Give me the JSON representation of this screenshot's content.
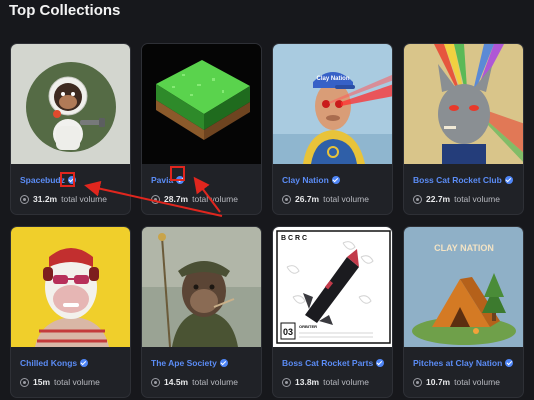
{
  "page": {
    "title": "Top Collections"
  },
  "collections": [
    {
      "name": "Spacebudz",
      "volume": "31.2m",
      "volume_label": "total volume",
      "verified": true
    },
    {
      "name": "Pavia",
      "volume": "28.7m",
      "volume_label": "total volume",
      "verified": true
    },
    {
      "name": "Clay Nation",
      "volume": "26.7m",
      "volume_label": "total volume",
      "verified": true
    },
    {
      "name": "Boss Cat Rocket Club",
      "volume": "22.7m",
      "volume_label": "total volume",
      "verified": true
    },
    {
      "name": "Chilled Kongs",
      "volume": "15m",
      "volume_label": "total volume",
      "verified": true
    },
    {
      "name": "The Ape Society",
      "volume": "14.5m",
      "volume_label": "total volume",
      "verified": true
    },
    {
      "name": "Boss Cat Rocket Parts",
      "volume": "13.8m",
      "volume_label": "total volume",
      "verified": true
    },
    {
      "name": "Pitches at Clay Nation",
      "volume": "10.7m",
      "volume_label": "total volume",
      "verified": true
    }
  ],
  "artwork_text": {
    "clay_cap": "Clay Nation",
    "bcrc_header": "B C R C",
    "bcrc_number": "03",
    "bcrc_caption": "ORBITER",
    "pitches_logo": "CLAY NATION"
  },
  "icons": {
    "verified": "verified-badge-icon",
    "volume": "volume-icon"
  },
  "colors": {
    "background": "#17181c",
    "card": "#202227",
    "link": "#5b8cf5",
    "annotation": "#e0261e"
  }
}
